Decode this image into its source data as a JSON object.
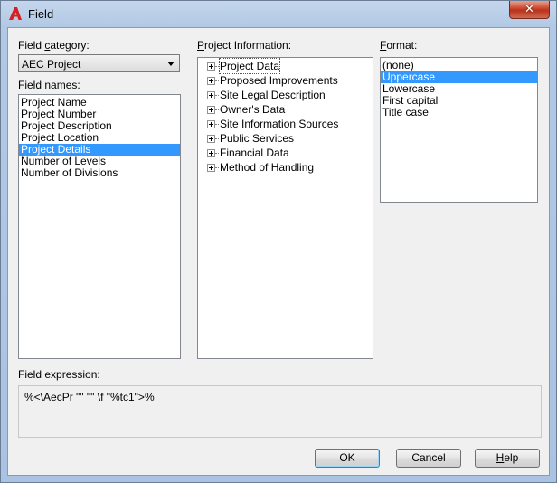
{
  "window": {
    "title": "Field",
    "close_glyph": "✕",
    "app_icon": "autocad-a-icon"
  },
  "field_category": {
    "label_pre": "Field ",
    "label_accel": "c",
    "label_post": "ategory:",
    "selected": "AEC Project"
  },
  "field_names": {
    "label_pre": "Field ",
    "label_accel": "n",
    "label_post": "ames:",
    "items": [
      "Project Name",
      "Project Number",
      "Project Description",
      "Project Location",
      "Project Details",
      "Number of Levels",
      "Number of Divisions"
    ],
    "selected_index": 4
  },
  "project_information": {
    "label_accel": "P",
    "label_post": "roject Information:",
    "items": [
      "Project Data",
      "Proposed Improvements",
      "Site Legal Description",
      "Owner's Data",
      "Site Information Sources",
      "Public Services",
      "Financial Data",
      "Method of Handling"
    ]
  },
  "format": {
    "label_accel": "F",
    "label_post": "ormat:",
    "items": [
      "(none)",
      "Uppercase",
      "Lowercase",
      "First capital",
      "Title case"
    ],
    "selected_index": 1
  },
  "field_expression": {
    "label": "Field expression:",
    "value": "%<\\AecPr \"\" \"\" \\f \"%tc1\">%"
  },
  "buttons": {
    "ok": "OK",
    "cancel": "Cancel",
    "help_accel": "H",
    "help_post": "elp"
  }
}
